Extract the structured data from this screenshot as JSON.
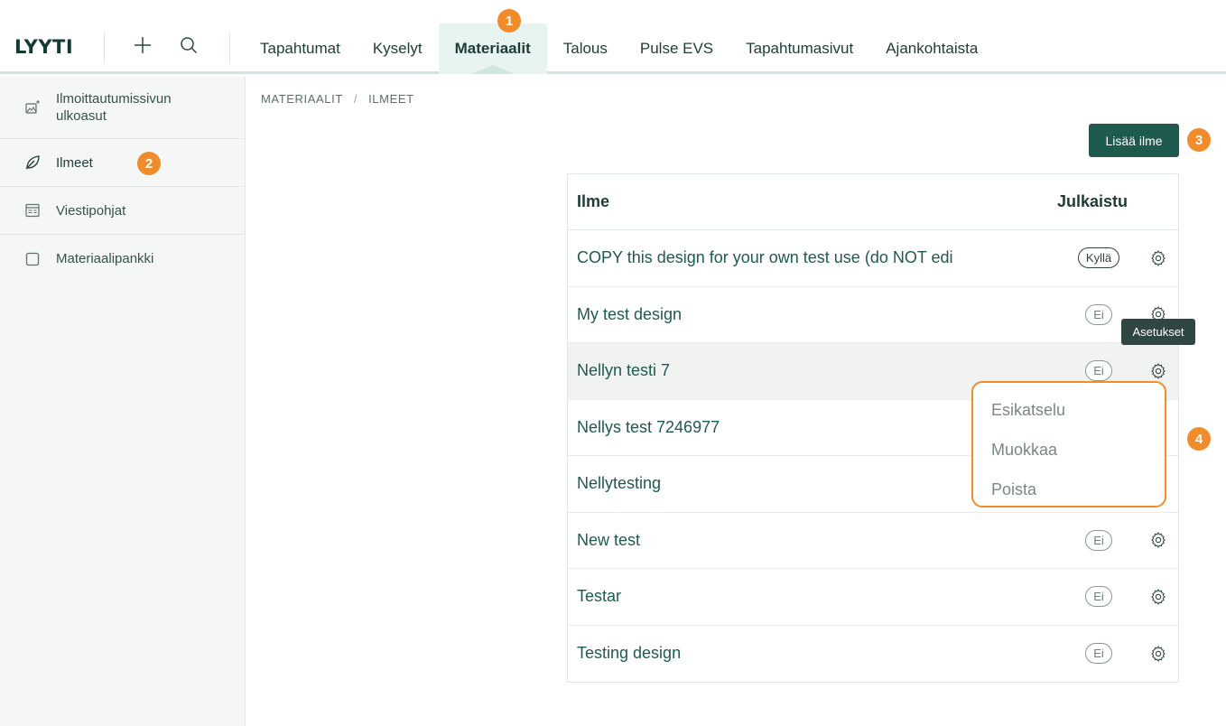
{
  "app": {
    "logo": "LYYTI"
  },
  "nav": {
    "tabs": [
      {
        "label": "Tapahtumat"
      },
      {
        "label": "Kyselyt"
      },
      {
        "label": "Materiaalit",
        "active": true
      },
      {
        "label": "Talous"
      },
      {
        "label": "Pulse EVS"
      },
      {
        "label": "Tapahtumasivut"
      },
      {
        "label": "Ajankohtaista"
      }
    ]
  },
  "sidebar": {
    "items": [
      {
        "label": "Ilmoittautumissivun ulkoasut",
        "icon": "image-sparkle-icon"
      },
      {
        "label": "Ilmeet",
        "icon": "leaf-icon",
        "active": true
      },
      {
        "label": "Viestipohjat",
        "icon": "template-icon"
      },
      {
        "label": "Materiaalipankki",
        "icon": "square-icon"
      }
    ]
  },
  "breadcrumb": {
    "first": "MATERIAALIT",
    "separator": "/",
    "second": "ILMEET"
  },
  "toolbar": {
    "add_label": "Lisää ilme"
  },
  "table": {
    "headers": {
      "name": "Ilme",
      "published": "Julkaistu"
    },
    "rows": [
      {
        "name": "COPY this design for your own test use (do NOT edi",
        "published": "Kyllä"
      },
      {
        "name": "My test design",
        "published": "Ei"
      },
      {
        "name": "Nellyn testi 7",
        "published": "Ei"
      },
      {
        "name": "Nellys test 7246977",
        "published": ""
      },
      {
        "name": "Nellytesting",
        "published": ""
      },
      {
        "name": "New test",
        "published": "Ei"
      },
      {
        "name": "Testar",
        "published": "Ei"
      },
      {
        "name": "Testing design",
        "published": "Ei"
      }
    ]
  },
  "tooltip": {
    "text": "Asetukset"
  },
  "context_menu": {
    "items": [
      "Esikatselu",
      "Muokkaa",
      "Poista"
    ]
  },
  "callouts": [
    "1",
    "2",
    "3",
    "4"
  ],
  "colors": {
    "accent": "#1e5a4e",
    "callout": "#f08c2c",
    "active_tab": "#e8f4f1"
  }
}
